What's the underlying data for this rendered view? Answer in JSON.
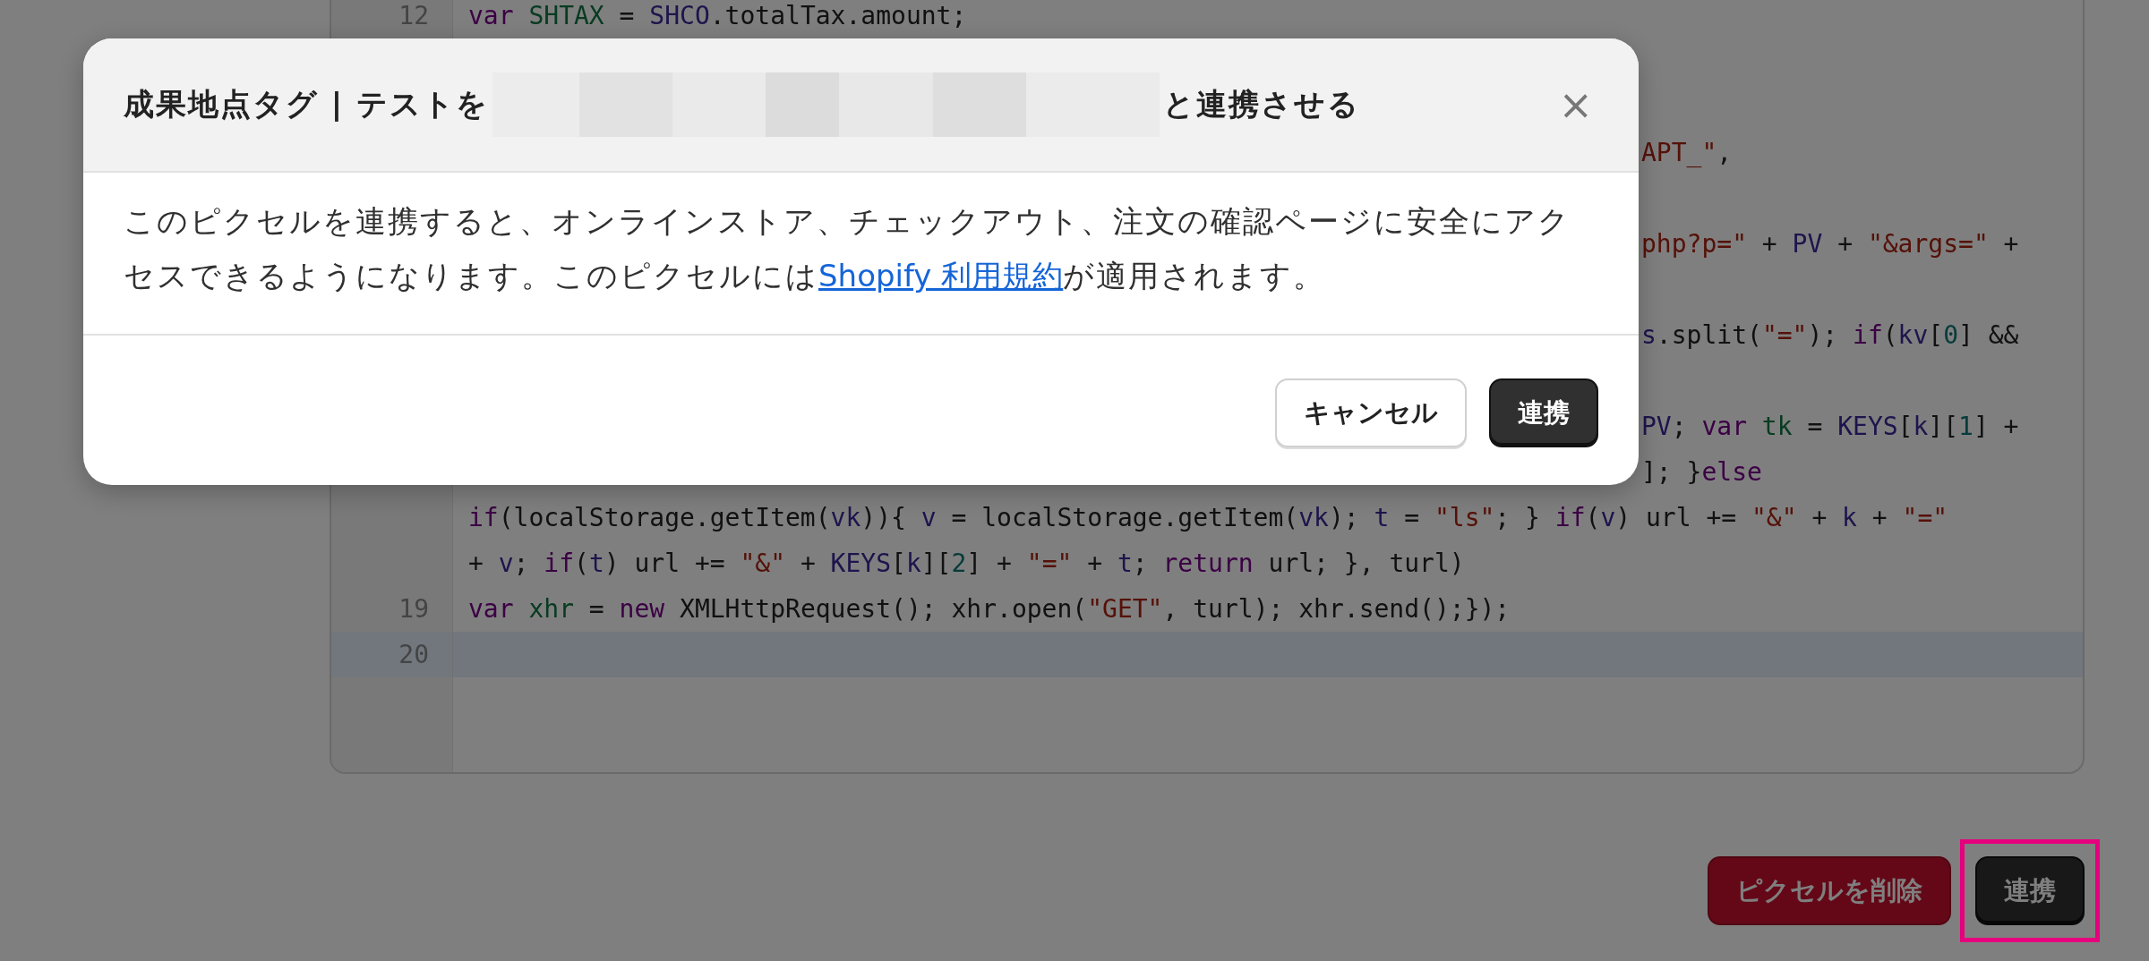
{
  "editor": {
    "rows": [
      {
        "kind": "numbered",
        "number": "12",
        "tokens": [
          {
            "kind": "keyword",
            "text": "var"
          },
          {
            "kind": "def",
            "text": " SHTAX"
          },
          {
            "kind": "plain",
            "text": " = "
          },
          {
            "kind": "var",
            "text": "SHCO"
          },
          {
            "kind": "plain",
            "text": ".totalTax.amount;"
          }
        ]
      },
      {
        "kind": "covered"
      },
      {
        "kind": "covered"
      },
      {
        "kind": "clipped",
        "active": false,
        "tokens": [
          {
            "kind": "string",
            "text": "APT_\""
          },
          {
            "kind": "plain",
            "text": ","
          }
        ]
      },
      {
        "kind": "covered"
      },
      {
        "kind": "clipped",
        "active": false,
        "tokens": [
          {
            "kind": "string",
            "text": "php?p=\""
          },
          {
            "kind": "plain",
            "text": " + "
          },
          {
            "kind": "var",
            "text": "PV"
          },
          {
            "kind": "plain",
            "text": " + "
          },
          {
            "kind": "string",
            "text": "\"&args=\""
          },
          {
            "kind": "plain",
            "text": " +"
          }
        ]
      },
      {
        "kind": "covered"
      },
      {
        "kind": "clipped",
        "active": false,
        "tokens": [
          {
            "kind": "var",
            "text": "s"
          },
          {
            "kind": "plain",
            "text": ".split("
          },
          {
            "kind": "string",
            "text": "\"=\""
          },
          {
            "kind": "plain",
            "text": "); "
          },
          {
            "kind": "keyword",
            "text": "if"
          },
          {
            "kind": "plain",
            "text": "("
          },
          {
            "kind": "var",
            "text": "kv"
          },
          {
            "kind": "plain",
            "text": "["
          },
          {
            "kind": "number",
            "text": "0"
          },
          {
            "kind": "plain",
            "text": "] &&"
          }
        ]
      },
      {
        "kind": "covered"
      },
      {
        "kind": "clipped",
        "active": false,
        "tokens": [
          {
            "kind": "var",
            "text": "PV"
          },
          {
            "kind": "plain",
            "text": "; "
          },
          {
            "kind": "keyword",
            "text": "var"
          },
          {
            "kind": "def",
            "text": " tk"
          },
          {
            "kind": "plain",
            "text": " = "
          },
          {
            "kind": "var",
            "text": "KEYS"
          },
          {
            "kind": "plain",
            "text": "["
          },
          {
            "kind": "var",
            "text": "k"
          },
          {
            "kind": "plain",
            "text": "]["
          },
          {
            "kind": "number",
            "text": "1"
          },
          {
            "kind": "plain",
            "text": "] +"
          }
        ]
      },
      {
        "kind": "clipped",
        "active": false,
        "tokens": [
          {
            "kind": "plain",
            "text": "]; }"
          },
          {
            "kind": "keyword",
            "text": "else"
          }
        ]
      },
      {
        "kind": "wrapped",
        "active": false,
        "tokens": [
          {
            "kind": "keyword",
            "text": "if"
          },
          {
            "kind": "plain",
            "text": "(localStorage.getItem("
          },
          {
            "kind": "var",
            "text": "vk"
          },
          {
            "kind": "plain",
            "text": ")){ "
          },
          {
            "kind": "var",
            "text": "v"
          },
          {
            "kind": "plain",
            "text": " = localStorage.getItem("
          },
          {
            "kind": "var",
            "text": "vk"
          },
          {
            "kind": "plain",
            "text": "); "
          },
          {
            "kind": "var",
            "text": "t"
          },
          {
            "kind": "plain",
            "text": " = "
          },
          {
            "kind": "string",
            "text": "\"ls\""
          },
          {
            "kind": "plain",
            "text": "; } "
          },
          {
            "kind": "keyword",
            "text": "if"
          },
          {
            "kind": "plain",
            "text": "("
          },
          {
            "kind": "var",
            "text": "v"
          },
          {
            "kind": "plain",
            "text": ") url += "
          },
          {
            "kind": "string",
            "text": "\"&\""
          },
          {
            "kind": "plain",
            "text": " + "
          },
          {
            "kind": "var",
            "text": "k"
          },
          {
            "kind": "plain",
            "text": " + "
          },
          {
            "kind": "string",
            "text": "\"=\""
          }
        ]
      },
      {
        "kind": "wrapped",
        "active": false,
        "tokens": [
          {
            "kind": "plain",
            "text": "+ "
          },
          {
            "kind": "var",
            "text": "v"
          },
          {
            "kind": "plain",
            "text": "; "
          },
          {
            "kind": "keyword",
            "text": "if"
          },
          {
            "kind": "plain",
            "text": "("
          },
          {
            "kind": "var",
            "text": "t"
          },
          {
            "kind": "plain",
            "text": ") url += "
          },
          {
            "kind": "string",
            "text": "\"&\""
          },
          {
            "kind": "plain",
            "text": " + "
          },
          {
            "kind": "var",
            "text": "KEYS"
          },
          {
            "kind": "plain",
            "text": "["
          },
          {
            "kind": "var",
            "text": "k"
          },
          {
            "kind": "plain",
            "text": "]["
          },
          {
            "kind": "number",
            "text": "2"
          },
          {
            "kind": "plain",
            "text": "] + "
          },
          {
            "kind": "string",
            "text": "\"=\""
          },
          {
            "kind": "plain",
            "text": " + "
          },
          {
            "kind": "var",
            "text": "t"
          },
          {
            "kind": "plain",
            "text": "; "
          },
          {
            "kind": "keyword",
            "text": "return"
          },
          {
            "kind": "plain",
            "text": " url; }, turl)"
          }
        ]
      },
      {
        "kind": "numbered",
        "number": "19",
        "tokens": [
          {
            "kind": "keyword",
            "text": "var"
          },
          {
            "kind": "def",
            "text": " xhr"
          },
          {
            "kind": "plain",
            "text": " = "
          },
          {
            "kind": "keyword",
            "text": "new"
          },
          {
            "kind": "plain",
            "text": " XMLHttpRequest(); xhr.open("
          },
          {
            "kind": "string",
            "text": "\"GET\""
          },
          {
            "kind": "plain",
            "text": ", turl); xhr.send();});"
          }
        ]
      },
      {
        "kind": "numbered",
        "number": "20",
        "active": true,
        "tokens": []
      }
    ]
  },
  "actions": [
    {
      "kind": "danger",
      "label": "ピクセルを削除"
    },
    {
      "kind": "primary",
      "label": "連携",
      "highlighted": true
    }
  ],
  "dialog": {
    "title_parts": [
      {
        "kind": "text",
        "text": "成果地点タグ | テストを"
      },
      {
        "kind": "redacted"
      },
      {
        "kind": "text",
        "text": "と連携させる"
      }
    ],
    "close": "×",
    "body_before": "このピクセルを連携すると、オンラインストア、チェックアウト、注文の確認ページに安全にアクセスできるようになります。このピクセルには",
    "link": "Shopify 利用規約",
    "body_after": "が適用されます。",
    "buttons": [
      {
        "kind": "secondary",
        "label": "キャンセル"
      },
      {
        "kind": "primary",
        "label": "連携"
      }
    ]
  }
}
